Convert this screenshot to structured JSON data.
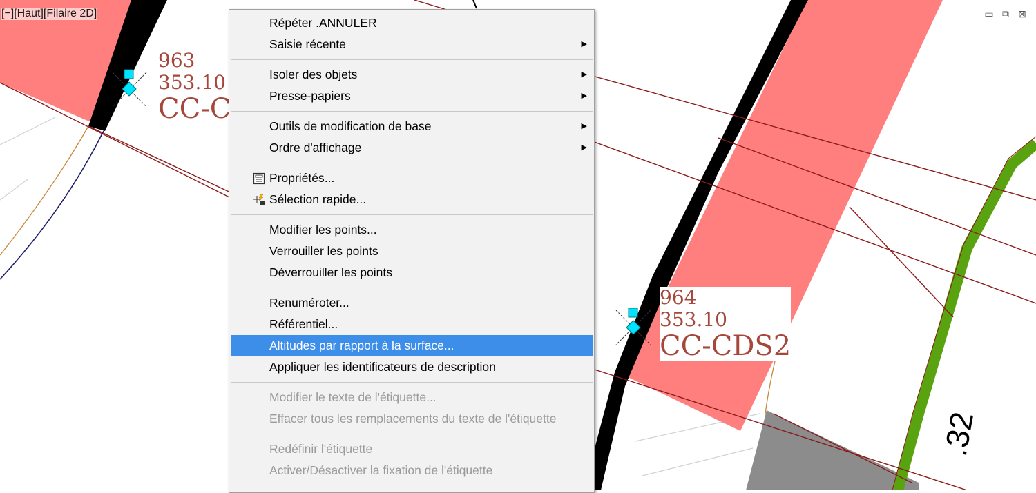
{
  "viewport": {
    "label": "[−][Haut][Filaire 2D]"
  },
  "window_controls": {
    "minimize": "▭",
    "restore": "⧉",
    "close": "⊠"
  },
  "point_labels": [
    {
      "number": "963",
      "elevation": "353.10",
      "code": "CC-C"
    },
    {
      "number": "964",
      "elevation": "353.10",
      "code": "CC-CDS2"
    }
  ],
  "dimension_text": ".32",
  "context_menu": {
    "groups": [
      [
        {
          "label": "Répéter .ANNULER",
          "submenu": false,
          "enabled": true
        },
        {
          "label": "Saisie récente",
          "submenu": true,
          "enabled": true
        }
      ],
      [
        {
          "label": "Isoler des objets",
          "submenu": true,
          "enabled": true
        },
        {
          "label": "Presse-papiers",
          "submenu": true,
          "enabled": true
        }
      ],
      [
        {
          "label": "Outils de modification de base",
          "submenu": true,
          "enabled": true
        },
        {
          "label": "Ordre d'affichage",
          "submenu": true,
          "enabled": true
        }
      ],
      [
        {
          "label": "Propriétés...",
          "submenu": false,
          "enabled": true,
          "icon": "properties-icon"
        },
        {
          "label": "Sélection rapide...",
          "submenu": false,
          "enabled": true,
          "icon": "quick-select-icon"
        }
      ],
      [
        {
          "label": "Modifier les points...",
          "submenu": false,
          "enabled": true
        },
        {
          "label": "Verrouiller les points",
          "submenu": false,
          "enabled": true
        },
        {
          "label": "Déverrouiller les points",
          "submenu": false,
          "enabled": true
        }
      ],
      [
        {
          "label": "Renuméroter...",
          "submenu": false,
          "enabled": true
        },
        {
          "label": "Référentiel...",
          "submenu": false,
          "enabled": true
        },
        {
          "label": "Altitudes par rapport à la surface...",
          "submenu": false,
          "enabled": true,
          "highlighted": true
        },
        {
          "label": "Appliquer les identificateurs de description",
          "submenu": false,
          "enabled": true
        }
      ],
      [
        {
          "label": "Modifier le texte de l'étiquette...",
          "submenu": false,
          "enabled": false
        },
        {
          "label": "Effacer tous les remplacements du texte de l'étiquette",
          "submenu": false,
          "enabled": false
        }
      ],
      [
        {
          "label": "Redéfinir l'étiquette",
          "submenu": false,
          "enabled": false
        },
        {
          "label": "Activer/Désactiver la fixation de l'étiquette",
          "submenu": false,
          "enabled": false
        }
      ]
    ],
    "submenu_arrow": "▶"
  },
  "colors": {
    "parcel_fill": "#ff7f7f",
    "road_edge": "#000000",
    "line_red": "#8b1a1a",
    "green_path": "#5aa310",
    "grey_block": "#8c8c8c",
    "highlight": "#3d8ee9",
    "label_text": "#a5473b",
    "grip": "#00e5ff"
  }
}
